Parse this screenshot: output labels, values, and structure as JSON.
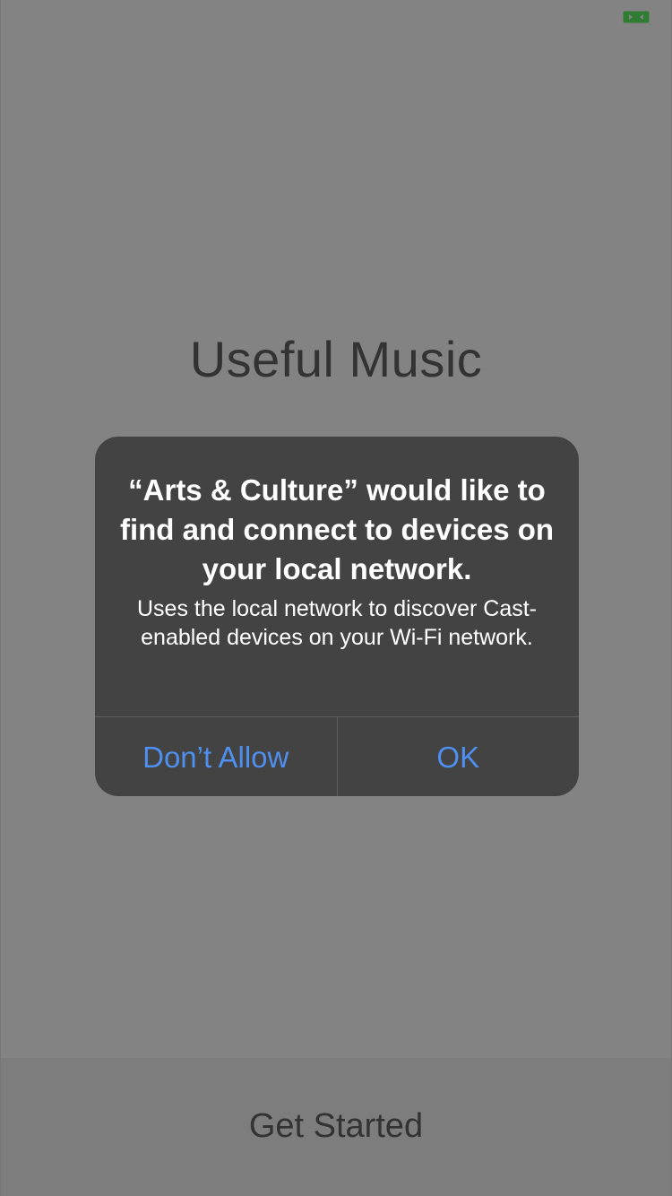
{
  "app": {
    "title": "Useful Music",
    "get_started_label": "Get Started"
  },
  "status_bar": {
    "icon": "screen-mirroring-icon",
    "icon_color": "#2e7d32"
  },
  "alert": {
    "title": "“Arts & Culture” would like to find and connect to devices on your local network.",
    "message": "Uses the local network to discover Cast-enabled devices on your Wi-Fi network.",
    "deny_label": "Don’t Allow",
    "ok_label": "OK",
    "button_color": "#4f8ff0"
  }
}
